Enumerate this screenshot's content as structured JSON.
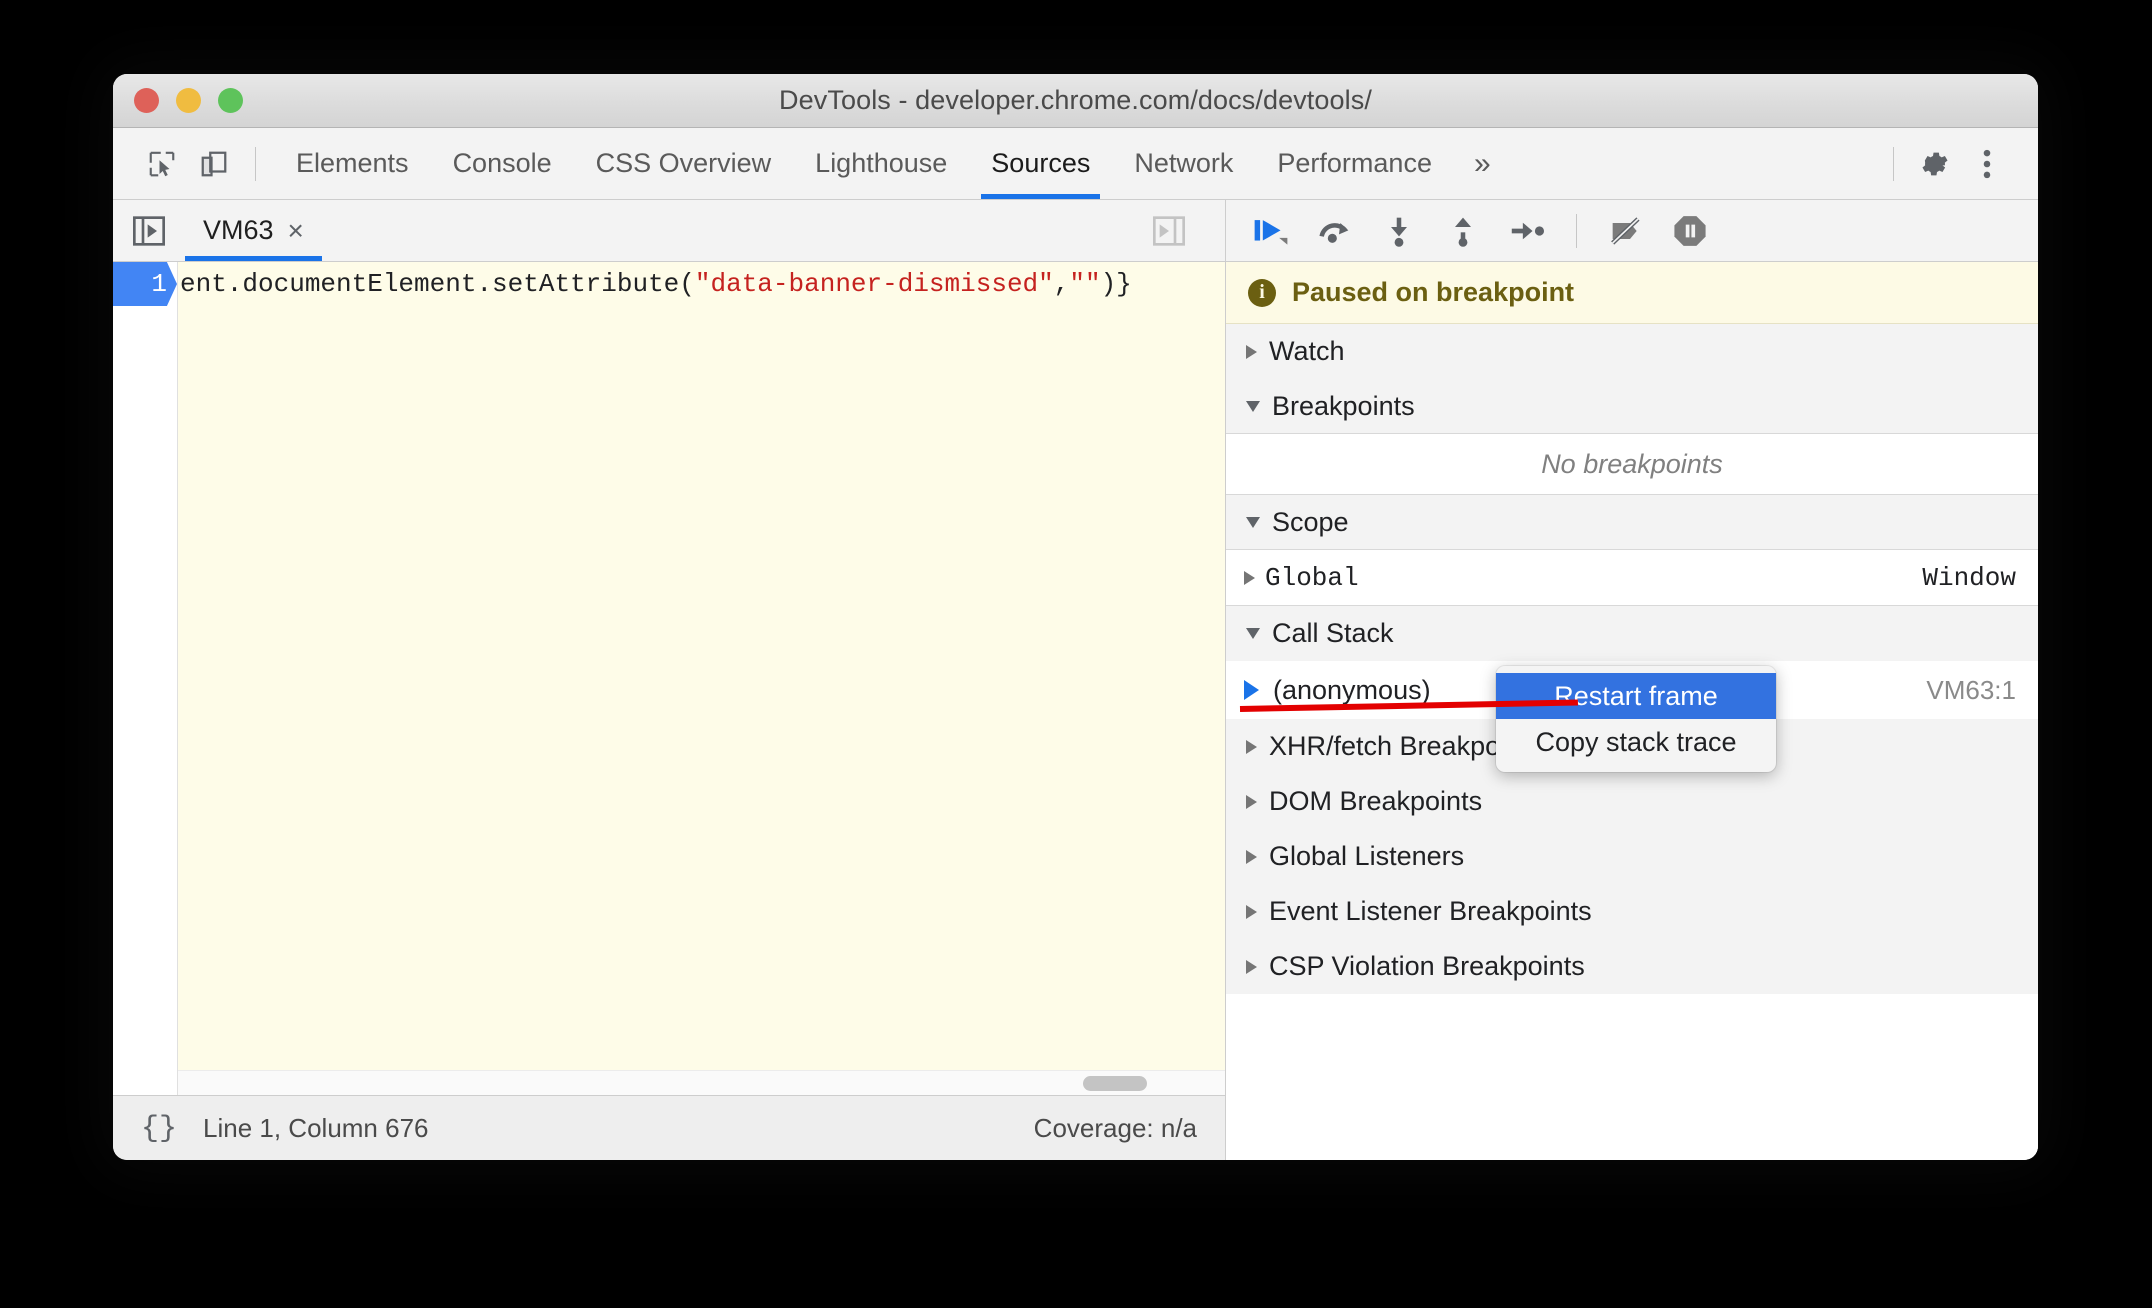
{
  "window": {
    "title": "DevTools - developer.chrome.com/docs/devtools/",
    "traffic_lights": [
      "close",
      "minimize",
      "maximize"
    ]
  },
  "toolbar": {
    "inspect_icon": "inspect-cursor-icon",
    "device_icon": "device-toolbar-icon",
    "tabs": [
      {
        "label": "Elements",
        "active": false
      },
      {
        "label": "Console",
        "active": false
      },
      {
        "label": "CSS Overview",
        "active": false
      },
      {
        "label": "Lighthouse",
        "active": false
      },
      {
        "label": "Sources",
        "active": true
      },
      {
        "label": "Network",
        "active": false
      },
      {
        "label": "Performance",
        "active": false
      }
    ],
    "more_tabs": "»",
    "settings_icon": "gear-icon",
    "menu_icon": "kebab-menu-icon",
    "active_accent": "#1a73e8"
  },
  "editor": {
    "navigator_toggle": "show-navigator-icon",
    "sidebar_toggle": "show-debugger-icon",
    "file_tab": {
      "name": "VM63",
      "close": "×"
    },
    "line_number": "1",
    "code_prefix": "ent.documentElement.setAttribute(",
    "code_string1": "\"data-banner-dismissed\"",
    "code_comma": ",",
    "code_string2": "\"\"",
    "code_suffix": ")}",
    "string_color": "#c5221f",
    "background": "#fefce8"
  },
  "status_bar": {
    "pretty_print_icon": "{}",
    "cursor_position": "Line 1, Column 676",
    "coverage": "Coverage: n/a"
  },
  "debugger_toolbar": {
    "buttons": [
      {
        "name": "resume-script-execution",
        "icon": "resume-icon"
      },
      {
        "name": "step-over-next-function-call",
        "icon": "step-over-icon"
      },
      {
        "name": "step-into-next-function-call",
        "icon": "step-into-icon"
      },
      {
        "name": "step-out-of-current-function",
        "icon": "step-out-icon"
      },
      {
        "name": "step",
        "icon": "step-icon"
      },
      {
        "name": "deactivate-breakpoints",
        "icon": "deactivate-breakpoints-icon"
      },
      {
        "name": "pause-on-exceptions",
        "icon": "pause-on-exceptions-icon"
      }
    ],
    "resume_color": "#1a73e8"
  },
  "paused_banner": {
    "icon": "info-icon",
    "text": "Paused on breakpoint",
    "background": "#fdfae5",
    "text_color": "#6b5f11"
  },
  "sidebar": {
    "sections": [
      {
        "label": "Watch",
        "expanded": false
      },
      {
        "label": "Breakpoints",
        "expanded": true
      },
      {
        "label": "Scope",
        "expanded": true
      },
      {
        "label": "Call Stack",
        "expanded": true
      },
      {
        "label": "XHR/fetch Breakpoints",
        "expanded": false
      },
      {
        "label": "DOM Breakpoints",
        "expanded": false
      },
      {
        "label": "Global Listeners",
        "expanded": false
      },
      {
        "label": "Event Listener Breakpoints",
        "expanded": false
      },
      {
        "label": "CSP Violation Breakpoints",
        "expanded": false
      }
    ],
    "breakpoints_empty": "No breakpoints",
    "scope": {
      "name": "Global",
      "value": "Window"
    },
    "call_stack": {
      "frame": "(anonymous)",
      "location": "VM63:1"
    }
  },
  "context_menu": {
    "items": [
      {
        "label": "Restart frame",
        "selected": true
      },
      {
        "label": "Copy stack trace",
        "selected": false
      }
    ],
    "selected_color": "#3372e0",
    "annotation_color": "#e30000"
  }
}
